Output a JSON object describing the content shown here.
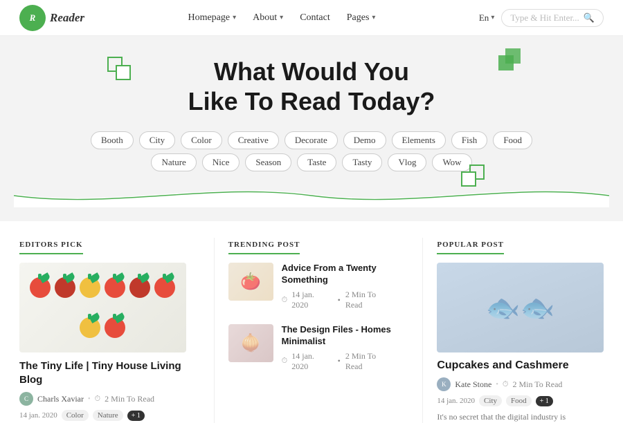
{
  "header": {
    "logo_letter": "Reader",
    "nav": [
      {
        "label": "Homepage",
        "has_dropdown": true
      },
      {
        "label": "About",
        "has_dropdown": true
      },
      {
        "label": "Contact",
        "has_dropdown": false
      },
      {
        "label": "Pages",
        "has_dropdown": true
      }
    ],
    "lang": "En",
    "search_placeholder": "Type & Hit Enter..."
  },
  "hero": {
    "title_line1": "What Would You",
    "title_line2": "Like To Read Today?",
    "tags": [
      "Booth",
      "City",
      "Color",
      "Creative",
      "Decorate",
      "Demo",
      "Elements",
      "Fish",
      "Food",
      "Nature",
      "Nice",
      "Season",
      "Taste",
      "Tasty",
      "Vlog",
      "Wow"
    ]
  },
  "sections": {
    "editors_pick": {
      "label": "EDITORS PICK",
      "post": {
        "title": "The Tiny Life | Tiny House Living Blog",
        "author": "Charls Xaviar",
        "read_time": "2 Min To Read",
        "date": "14 jan. 2020",
        "tags": [
          "Color",
          "Nature"
        ],
        "extra": "+ 1"
      }
    },
    "trending_post": {
      "label": "TRENDING POST",
      "posts": [
        {
          "title": "Advice From a Twenty Something",
          "date": "14 jan. 2020",
          "read_time": "2 Min To Read"
        },
        {
          "title": "The Design Files - Homes Minimalist",
          "date": "14 jan. 2020",
          "read_time": "2 Min To Read"
        }
      ]
    },
    "popular_post": {
      "label": "POPULAR POST",
      "post": {
        "title": "Cupcakes and Cashmere",
        "author": "Kate Stone",
        "read_time": "2 Min To Read",
        "date": "14 jan. 2020",
        "tags": [
          "City",
          "Food"
        ],
        "extra": "+ 1",
        "excerpt": "It's no secret that the digital industry is"
      }
    }
  }
}
